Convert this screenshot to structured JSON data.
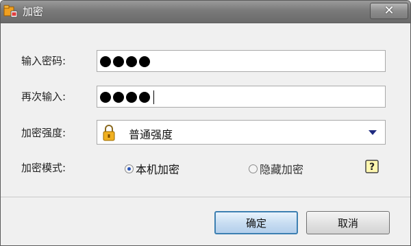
{
  "window": {
    "title": "加密",
    "close_label": "✕"
  },
  "form": {
    "password_label": "输入密码:",
    "password_value": "●●●●",
    "confirm_label": "再次输入:",
    "confirm_value": "●●●●",
    "strength_label": "加密强度:",
    "strength_value": "普通强度",
    "mode_label": "加密模式:",
    "mode_options": [
      {
        "label": "本机加密",
        "selected": true
      },
      {
        "label": "隐藏加密",
        "selected": false
      }
    ],
    "help_icon": "question-icon"
  },
  "buttons": {
    "ok_label": "确定",
    "cancel_label": "取消"
  },
  "colors": {
    "titlebar": "#7a7a7a",
    "ok_border": "#3c7fb1",
    "radio_selected": "#2b55b8"
  }
}
